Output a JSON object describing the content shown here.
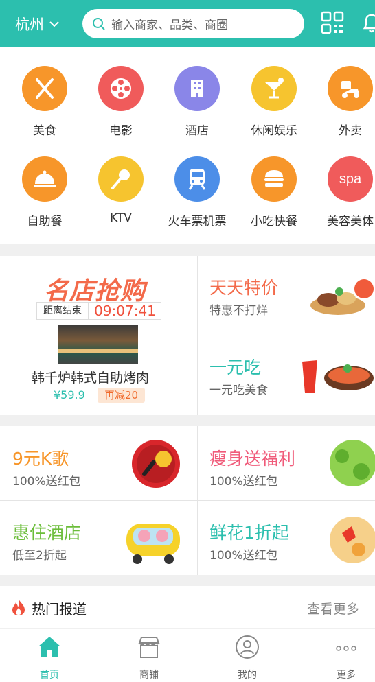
{
  "header": {
    "city": "杭州",
    "search_placeholder": "输入商家、品类、商圈"
  },
  "categories": [
    {
      "label": "美食",
      "color": "#f7962a",
      "icon": "fork-knife-icon"
    },
    {
      "label": "电影",
      "color": "#f05b5b",
      "icon": "film-reel-icon"
    },
    {
      "label": "酒店",
      "color": "#8a86e8",
      "icon": "building-icon"
    },
    {
      "label": "休闲娱乐",
      "color": "#f6c42f",
      "icon": "cocktail-icon"
    },
    {
      "label": "外卖",
      "color": "#f7962a",
      "icon": "scooter-icon"
    },
    {
      "label": "自助餐",
      "color": "#f7962a",
      "icon": "cloche-icon"
    },
    {
      "label": "KTV",
      "color": "#f6c42f",
      "icon": "microphone-icon"
    },
    {
      "label": "火车票机票",
      "color": "#4c8ee8",
      "icon": "train-icon"
    },
    {
      "label": "小吃快餐",
      "color": "#f7962a",
      "icon": "burger-icon"
    },
    {
      "label": "美容美体",
      "color": "#f05b5b",
      "icon": "spa-icon",
      "icon_text": "spa"
    }
  ],
  "flash_sale": {
    "title": "名店抢购",
    "countdown_label": "距离结束",
    "countdown": "09:07:41",
    "shop_name": "韩千炉韩式自助烤肉",
    "price": "¥59.9",
    "rebate": "再减20"
  },
  "promos": [
    {
      "title": "天天特价",
      "sub": "特惠不打烊",
      "color": "#f36a4a"
    },
    {
      "title": "一元吃",
      "sub": "一元吃美食",
      "color": "#2cbfae"
    }
  ],
  "grid": [
    {
      "title": "9元K歌",
      "sub": "100%送红包",
      "color": "#f7962a"
    },
    {
      "title": "瘦身送福利",
      "sub": "100%送红包",
      "color": "#f05b7a"
    },
    {
      "title": "惠住酒店",
      "sub": "低至2折起",
      "color": "#6bbd3a"
    },
    {
      "title": "鲜花1折起",
      "sub": "100%送红包",
      "color": "#2cbfae"
    }
  ],
  "hot": {
    "title": "热门报道",
    "more": "查看更多"
  },
  "nav": [
    {
      "label": "首页"
    },
    {
      "label": "商铺"
    },
    {
      "label": "我的"
    },
    {
      "label": "更多"
    }
  ]
}
